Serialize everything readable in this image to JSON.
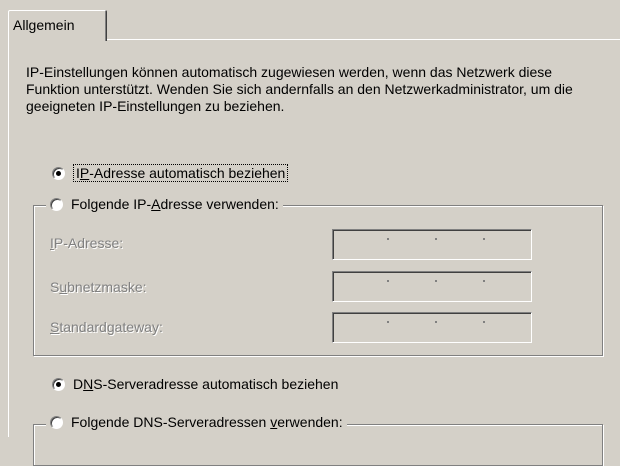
{
  "tab": {
    "label": "Allgemein"
  },
  "description": "IP-Einstellungen können automatisch zugewiesen werden, wenn das Netzwerk diese Funktion unterstützt. Wenden Sie sich andernfalls an den Netzwerkadministrator, um die geeigneten IP-Einstellungen zu beziehen.",
  "ip": {
    "auto": {
      "pre": "I",
      "key": "P",
      "post": "-Adresse automatisch beziehen",
      "checked": true
    },
    "manual": {
      "pre": "Folgende IP-",
      "key": "A",
      "post": "dresse verwenden:",
      "checked": false
    },
    "fields": [
      {
        "pre": "",
        "key": "I",
        "post": "P-Adresse:",
        "value": ". . ."
      },
      {
        "pre": "S",
        "key": "u",
        "post": "bnetzmaske:",
        "value": ". . ."
      },
      {
        "pre": "",
        "key": "S",
        "post": "tandardgateway:",
        "value": ". . ."
      }
    ]
  },
  "dns": {
    "auto": {
      "pre": "D",
      "key": "N",
      "post": "S-Serveradresse automatisch beziehen",
      "checked": true
    },
    "manual": {
      "pre": "Folgende DNS-Serveradressen ",
      "key": "v",
      "post": "erwenden:",
      "checked": false
    }
  }
}
